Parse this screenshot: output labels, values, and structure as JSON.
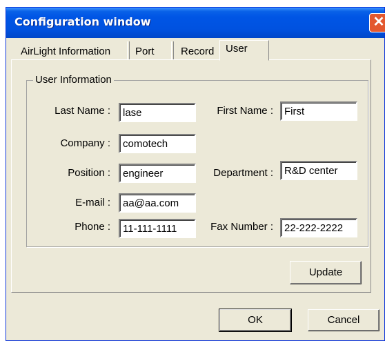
{
  "window": {
    "title": "Configuration window",
    "close_label": "✕"
  },
  "tabs": [
    {
      "label": "AirLight Information"
    },
    {
      "label": "Port"
    },
    {
      "label": "Record"
    },
    {
      "label": "User"
    }
  ],
  "group": {
    "label": "User Information"
  },
  "fields": {
    "last_name": {
      "label": "Last Name :",
      "value": "lase"
    },
    "first_name": {
      "label": "First Name :",
      "value": "First"
    },
    "company": {
      "label": "Company :",
      "value": "comotech"
    },
    "position": {
      "label": "Position :",
      "value": "engineer"
    },
    "department": {
      "label": "Department :",
      "value": "R&D center"
    },
    "email": {
      "label": "E-mail :",
      "value": "aa@aa.com"
    },
    "phone": {
      "label": "Phone :",
      "value": "11-111-1111"
    },
    "fax": {
      "label": "Fax Number :",
      "value": "22-222-2222"
    }
  },
  "buttons": {
    "update": "Update",
    "ok": "OK",
    "cancel": "Cancel"
  }
}
